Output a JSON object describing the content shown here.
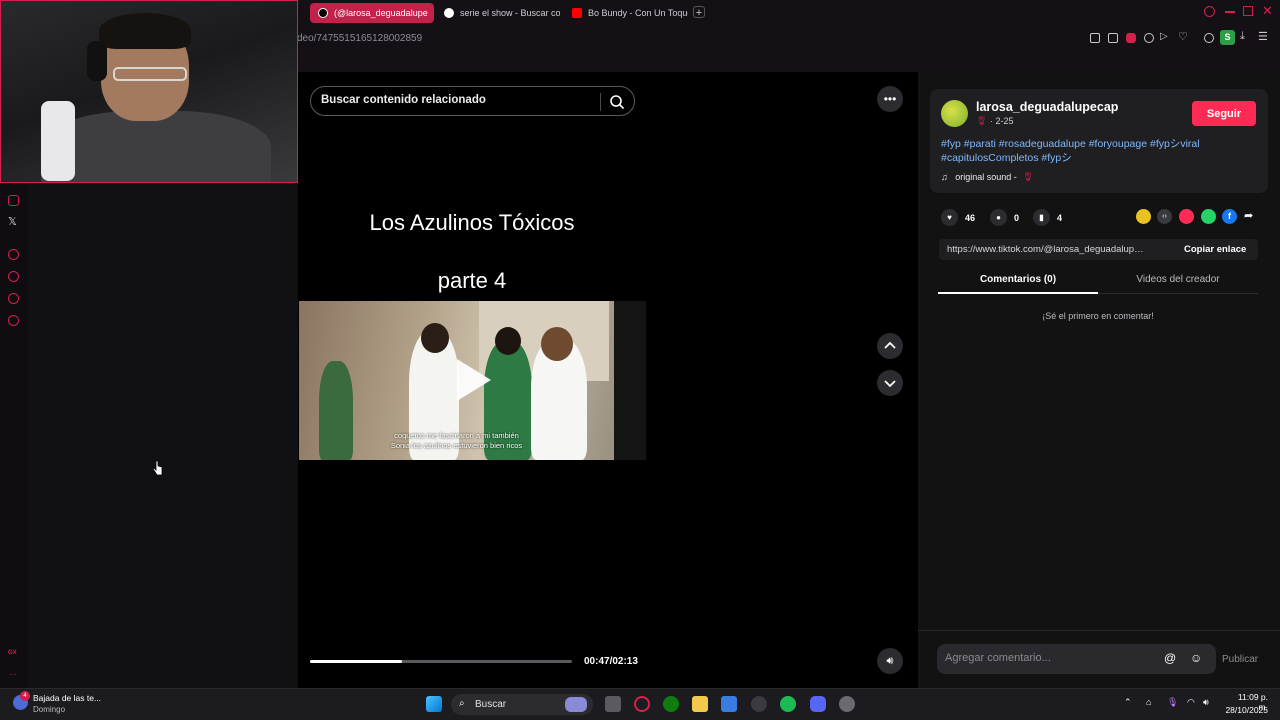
{
  "browser": {
    "tabs": [
      {
        "label": "(@larosa_deguadalupe",
        "active": true,
        "icon": "tiktok-icon"
      },
      {
        "label": "serie el show - Buscar co",
        "active": false,
        "icon": "google-icon"
      },
      {
        "label": "Bo Bundy - Con Un Toque",
        "active": false,
        "icon": "youtube-icon"
      }
    ],
    "url_fragment": "deo/7475515165128002859"
  },
  "search": {
    "placeholder": "Buscar contenido relacionado"
  },
  "video": {
    "title": "Los Azulinos Tóxicos",
    "subtitle": "parte 4",
    "caption_line1": "coquetos me fascinaron a mi también",
    "caption_line2": "Sonia los azulinos estuvieron bien ricos",
    "time": "00:47/02:13",
    "progress": 0.353
  },
  "post": {
    "username": "larosa_deguadalupecap",
    "date": "· 2-25",
    "follow_label": "Seguir",
    "hashtags": "#fyp #parati #rosadeguadalupe #foryoupage #fypシviral #capitulosCompletos #fypシ",
    "sound": "original sound -",
    "likes": "46",
    "comments_count": "0",
    "saves": "4",
    "link": "https://www.tiktok.com/@larosa_deguadalupecap/...",
    "copy_label": "Copiar enlace",
    "tabs": {
      "comments": "Comentarios (0)",
      "creator": "Videos del creador"
    },
    "empty_comments": "¡Sé el primero en comentar!",
    "comment_placeholder": "Agregar comentario...",
    "publish_label": "Publicar"
  },
  "taskbar": {
    "weather_title": "Bajada de las te...",
    "weather_sub": "Domingo",
    "search_label": "Buscar",
    "time": "11:09 p. m.",
    "date": "28/10/2025",
    "badge_notifications": "4"
  },
  "colors": {
    "accent": "#fe2c55",
    "link": "#7fb8ff",
    "opera_accent": "#d4204a"
  }
}
